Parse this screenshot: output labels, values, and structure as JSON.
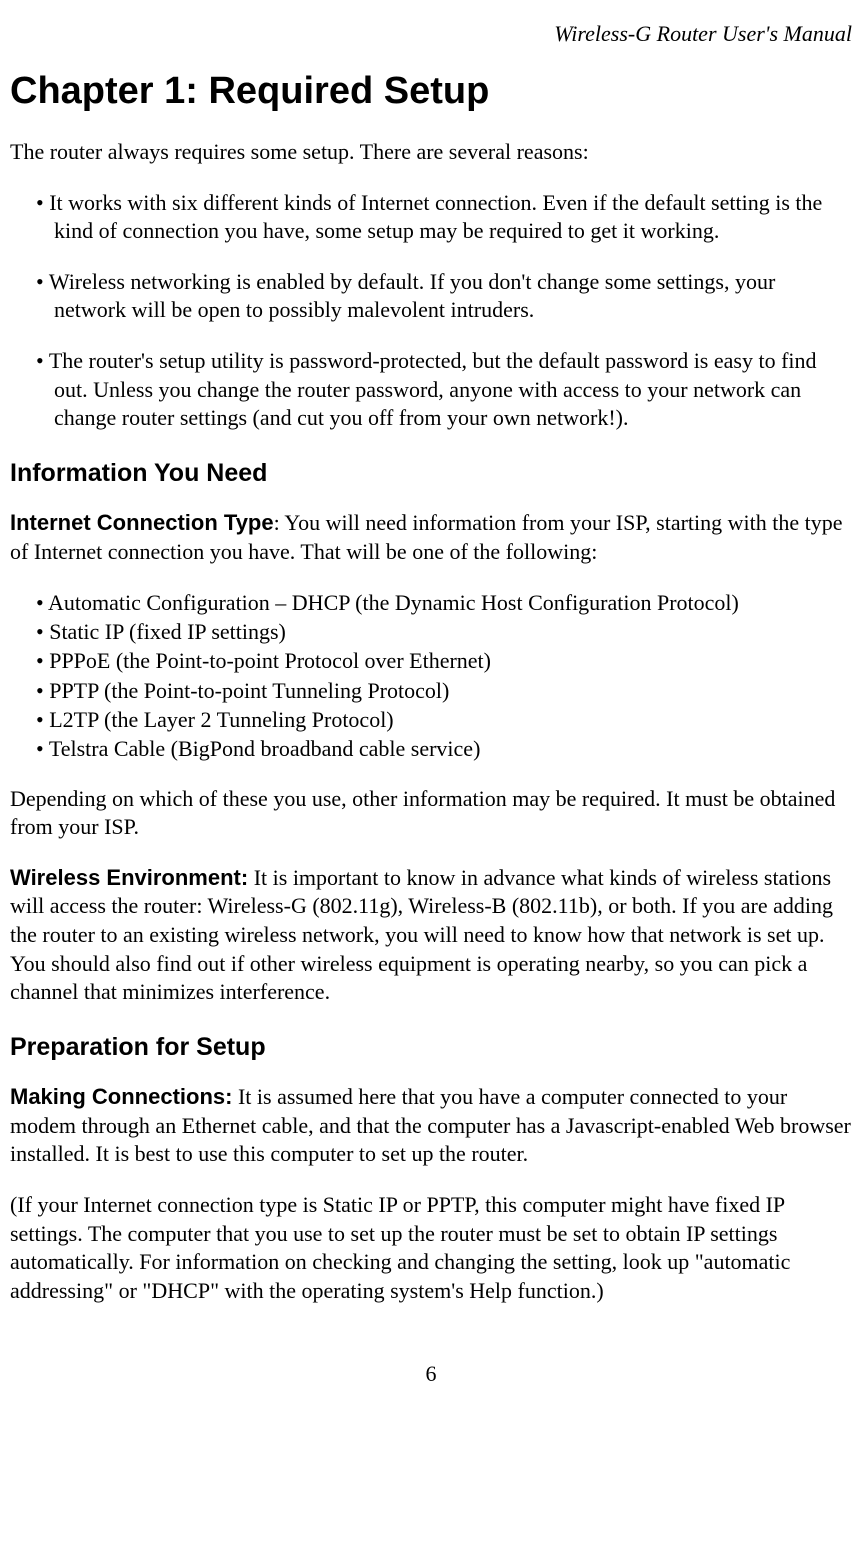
{
  "header": "Wireless-G Router User's Manual",
  "chapter_title": "Chapter 1: Required Setup",
  "intro": "The router always requires some setup. There are several reasons:",
  "reasons": [
    "It works with six different kinds of Internet connection. Even if the default setting is the kind of connection you have, some setup may be required to get it working.",
    "Wireless networking is enabled by default. If you don't change some settings, your network will be open to possibly malevolent intruders.",
    "The router's setup utility is password-protected, but the default password is easy to find out. Unless you change the router password, anyone with access to your network can change router settings (and cut you off from your own network!)."
  ],
  "section1_heading": "Information You Need",
  "section1_label": "Internet Connection Type",
  "section1_text": ": You will need information from your ISP, starting with the type of Internet connection you have. That will be one of the following:",
  "connection_types": [
    "Automatic Configuration – DHCP (the Dynamic Host Configuration Protocol)",
    "Static IP (fixed IP settings)",
    "PPPoE (the Point-to-point Protocol over Ethernet)",
    "PPTP (the Point-to-point Tunneling Protocol)",
    "L2TP (the Layer 2 Tunneling Protocol)",
    "Telstra Cable (BigPond broadband cable service)"
  ],
  "section1_after": "Depending on which of these you use, other information may be required. It must be obtained from your ISP.",
  "wireless_label": "Wireless Environment:",
  "wireless_text": " It is important to know in advance what kinds of wireless stations will access the router: Wireless-G (802.11g), Wireless-B (802.11b), or both. If you are adding the router to an existing wireless network, you will need to know how that network is set up. You should also find out if other wireless equipment is operating nearby, so you can pick a channel that minimizes interference.",
  "section2_heading": "Preparation for Setup",
  "making_label": "Making Connections:",
  "making_text": " It is assumed here that you have a computer connected to your modem through an Ethernet cable, and that the computer has a Javascript-enabled Web browser installed. It is best to use this computer to set up the router.",
  "paren_text": "(If your Internet connection type is Static IP or PPTP, this computer might have fixed IP settings. The computer that you use to set up the router must be set to obtain IP settings automatically. For information on checking and changing the setting, look up \"automatic addressing\" or \"DHCP\" with the operating system's Help function.)",
  "page_number": "6"
}
